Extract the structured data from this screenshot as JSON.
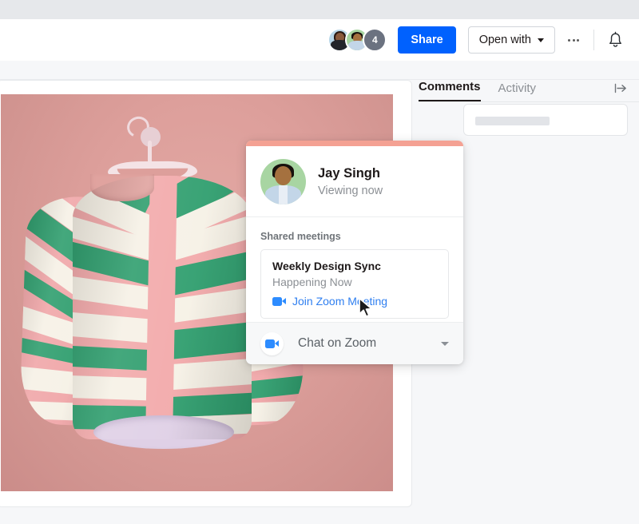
{
  "header": {
    "avatars": [
      {
        "name": "avatar-user-1",
        "alt": "Collaborator 1"
      },
      {
        "name": "avatar-user-2",
        "alt": "Collaborator 2"
      }
    ],
    "overflow_count": "4",
    "share_label": "Share",
    "open_with_label": "Open with",
    "more_icon": "ellipsis-icon",
    "bell_icon": "bell-icon"
  },
  "panel": {
    "tabs": [
      {
        "label": "Comments",
        "active": true
      },
      {
        "label": "Activity",
        "active": false
      }
    ],
    "collapse_icon": "collapse-panel-icon",
    "comment_input_placeholder": ""
  },
  "preview": {
    "alt": "Striped pink green and cream blouse on a hanger against a dusty pink background",
    "background_color": "#dd9f9b"
  },
  "popover": {
    "accent_color": "#f4a193",
    "user": {
      "name": "Jay Singh",
      "status": "Viewing now",
      "avatar_icon": "user-avatar"
    },
    "section_title": "Shared meetings",
    "meeting": {
      "title": "Weekly Design Sync",
      "subtitle": "Happening Now",
      "join_label": "Join Zoom Meeting",
      "join_icon": "zoom-camera-icon",
      "join_color": "#2f7ff0"
    },
    "footer": {
      "label": "Chat on Zoom",
      "icon": "zoom-camera-icon",
      "caret_icon": "chevron-down-icon"
    }
  },
  "cursor": {
    "icon": "mouse-pointer-icon"
  },
  "colors": {
    "brand_blue": "#0061fe",
    "zoom_blue": "#2d8cff",
    "accent_coral": "#f4a193"
  }
}
